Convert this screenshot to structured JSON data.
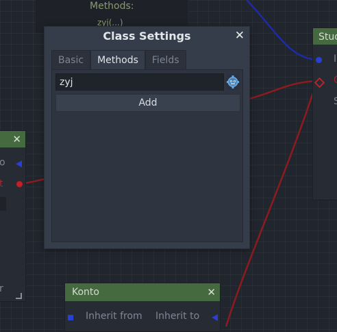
{
  "background_nodes": {
    "top_node": {
      "label": "Methods:",
      "item": "zyj(...)"
    },
    "left_node": {
      "port_o": "o",
      "port_t": "t",
      "port_r": "r"
    },
    "right_node": {
      "title": "Stud",
      "port_i": "I",
      "port_c": "C",
      "port_s": "S"
    },
    "bottom_node": {
      "title": "Konto",
      "inherit_from": "Inherit from",
      "inherit_to": "Inherit to"
    }
  },
  "dialog": {
    "title": "Class Settings",
    "close_glyph": "✕",
    "tabs": [
      {
        "label": "Basic",
        "active": false
      },
      {
        "label": "Methods",
        "active": true
      },
      {
        "label": "Fields",
        "active": false
      }
    ],
    "method_input": {
      "value": "zyj",
      "placeholder": ""
    },
    "gear_icon": "godot-gear-icon",
    "add_label": "Add"
  },
  "colors": {
    "node_title_green": "#466a3f",
    "connection_red": "#8e1b1f",
    "connection_blue": "#1e2ba6",
    "port_blue": "#2a3fd6",
    "port_red": "#c21f28"
  }
}
